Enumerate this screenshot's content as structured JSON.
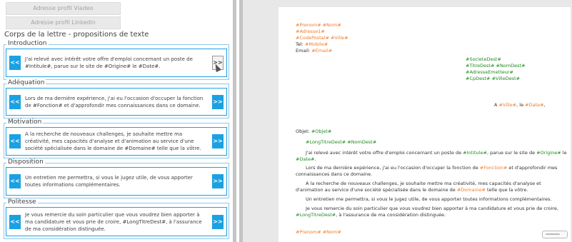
{
  "left_panel": {
    "btn_viadeo": "Adresse profil Viadeo",
    "btn_linkedin": "Adresse profil Linkedin",
    "section_title": "Corps de la lettre - propositions de texte",
    "left_arrow": "<<",
    "right_arrow": ">>",
    "groups": [
      {
        "label": "Introduction",
        "text": "J'ai relevé avec intérêt votre offre d'emploi concernant un poste de #Intitule#, parue sur le site de #Origine# le #Date#."
      },
      {
        "label": "Adéquation",
        "text": "Lors de ma dernière expérience, j'ai eu l'occasion d'occuper la fonction de #Fonction# et d'approfondir mes connaissances dans ce domaine."
      },
      {
        "label": "Motivation",
        "text": "A la recherche de nouveaux challenges, je souhaite mettre ma créativité, mes capacités d'analyse et d'animation au service d'une société spécialisée dans le domaine de #Domaine# telle que la vôtre."
      },
      {
        "label": "Disposition",
        "text": "Un entretien me permettra, si vous le jugez utile, de vous apporter toutes informations complémentaires."
      },
      {
        "label": "Politesse",
        "text": "Je vous remercie du soin particulier que vous voudrez bien apporter à ma candidature et vous prie de croire, #LongTitreDest#, à l'assurance de ma considération distinguée."
      }
    ]
  },
  "colors": {
    "accent": "#1ba1e2",
    "field_orange": "#f07c2a",
    "field_green": "#1e8a1e"
  },
  "letter": {
    "sender_name": "#Prenom# #Nom#",
    "sender_address": "#Adresse1#",
    "sender_city": "#CodePostal# #Ville#",
    "tel_label": "Tel: ",
    "tel_value": "#Mobile#",
    "email_label": "Email: ",
    "email_value": "#Email#",
    "dest_company": "#SocieteDest#",
    "dest_name": "#TitreDest# #NomDest#",
    "dest_address": "#AdresseEmetteur#",
    "dest_city": "#CpDest# #VilleDest#",
    "place_prefix": "A ",
    "place_city": "#Ville#",
    "place_sep": ", le ",
    "place_date": "#Date#",
    "place_end": ",",
    "objet_label": "Objet: ",
    "objet_value": "#Objet#",
    "salutation": "#LongTitreDest# #NomDest#",
    "p1_a": "J'ai relevé avec intérêt votre offre d'emploi concernant un poste de ",
    "p1_f1": "#Intitule#",
    "p1_b": ", parue sur le site de ",
    "p1_f2": "#Origine#",
    "p1_c": " le ",
    "p1_f3": "#Date#",
    "p1_d": ".",
    "p2_a": "Lors de ma dernière expérience, j'ai eu l'occasion d'occuper la fonction de ",
    "p2_f1": "#Fonction#",
    "p2_b": " et d'approfondir mes connaissances dans ce domaine.",
    "p3_a": "A la recherche de nouveaux challenges, je souhaite mettre ma créativité, mes capacités d'analyse et d'animation au service d'une société spécialisée dans le domaine de ",
    "p3_f1": "#Domaine#",
    "p3_b": " telle que la vôtre.",
    "p4": "Un entretien me permettra, si vous le jugez utile, de vous apporter toutes informations complémentaires.",
    "p5_a": "Je vous remercie du soin particulier que vous voudrez bien apporter à ma candidature et vous prie de croire, ",
    "p5_f1": "#LongTitreDest#",
    "p5_b": ", à l'assurance de ma considération distinguée.",
    "signature": "#Prenom# #Nom#"
  }
}
